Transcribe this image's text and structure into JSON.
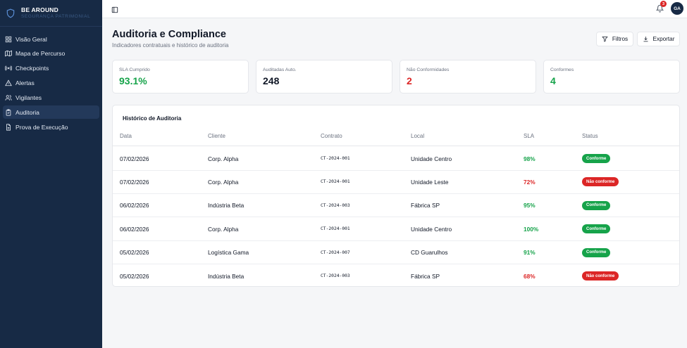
{
  "colors": {
    "sidebar_bg": "#172a45",
    "green": "#16a34a",
    "red": "#dc2626",
    "badge_green": "#16a34a",
    "badge_red": "#dc2626"
  },
  "brand": {
    "name": "BE AROUND",
    "subtitle": "SEGURANÇA PATRIMONIAL",
    "icon": "shield-icon"
  },
  "sidebar": {
    "items": [
      {
        "label": "Visão Geral",
        "icon": "grid-icon",
        "active": false
      },
      {
        "label": "Mapa de Percurso",
        "icon": "map-icon",
        "active": false
      },
      {
        "label": "Checkpoints",
        "icon": "radio-icon",
        "active": false
      },
      {
        "label": "Alertas",
        "icon": "alert-triangle-icon",
        "active": false
      },
      {
        "label": "Vigilantes",
        "icon": "users-icon",
        "active": false
      },
      {
        "label": "Auditoria",
        "icon": "clipboard-icon",
        "active": true
      },
      {
        "label": "Prova de Execução",
        "icon": "file-text-icon",
        "active": false
      }
    ]
  },
  "topbar": {
    "notifications_count": "3",
    "avatar_initials": "GA"
  },
  "page": {
    "title": "Auditoria e Compliance",
    "subtitle": "Indicadores contratuais e histórico de auditoria",
    "filters_label": "Filtros",
    "export_label": "Exportar"
  },
  "stats": [
    {
      "label": "SLA Cumprido",
      "value": "93.1%",
      "color": "#16a34a"
    },
    {
      "label": "Auditadas Auto.",
      "value": "248",
      "color": "#111827"
    },
    {
      "label": "Não Conformidades",
      "value": "2",
      "color": "#dc2626"
    },
    {
      "label": "Conformes",
      "value": "4",
      "color": "#16a34a"
    }
  ],
  "history": {
    "title": "Histórico de Auditoria",
    "columns": [
      "Data",
      "Cliente",
      "Contrato",
      "Local",
      "SLA",
      "Status"
    ],
    "rows": [
      {
        "date": "07/02/2026",
        "client": "Corp. Alpha",
        "contract": "CT-2024-001",
        "location": "Unidade Centro",
        "sla": "98%",
        "status": "Conforme",
        "ok": true
      },
      {
        "date": "07/02/2026",
        "client": "Corp. Alpha",
        "contract": "CT-2024-001",
        "location": "Unidade Leste",
        "sla": "72%",
        "status": "Não conforme",
        "ok": false
      },
      {
        "date": "06/02/2026",
        "client": "Indústria Beta",
        "contract": "CT-2024-003",
        "location": "Fábrica SP",
        "sla": "95%",
        "status": "Conforme",
        "ok": true
      },
      {
        "date": "06/02/2026",
        "client": "Corp. Alpha",
        "contract": "CT-2024-001",
        "location": "Unidade Centro",
        "sla": "100%",
        "status": "Conforme",
        "ok": true
      },
      {
        "date": "05/02/2026",
        "client": "Logística Gama",
        "contract": "CT-2024-007",
        "location": "CD Guarulhos",
        "sla": "91%",
        "status": "Conforme",
        "ok": true
      },
      {
        "date": "05/02/2026",
        "client": "Indústria Beta",
        "contract": "CT-2024-003",
        "location": "Fábrica SP",
        "sla": "68%",
        "status": "Não conforme",
        "ok": false
      }
    ]
  }
}
